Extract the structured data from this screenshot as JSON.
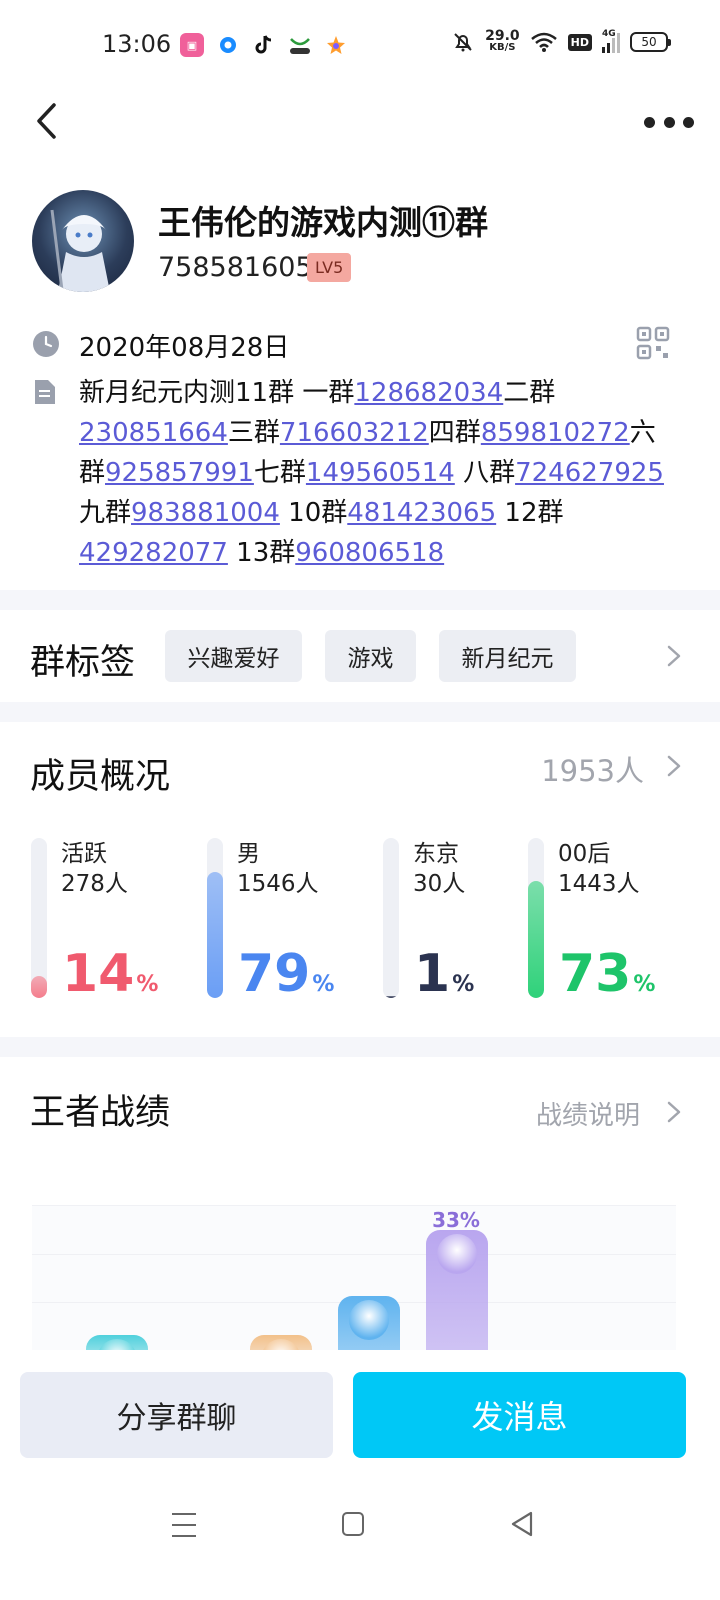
{
  "status_bar": {
    "time": "13:06",
    "speed_value": "29.0",
    "speed_unit": "KB/S",
    "hd_label": "HD",
    "network_label": "4G",
    "battery": "50",
    "app_icons": [
      "bilibili-icon",
      "browser-icon",
      "tiktok-icon",
      "game-icon",
      "star-app-icon"
    ]
  },
  "header": {
    "back_icon": "chevron-left-icon",
    "more_icon": "more-dots-icon"
  },
  "group": {
    "name": "王伟伦的游戏内测⑪群",
    "id": "758581605",
    "level": "LV5",
    "created_date": "2020年08月28日",
    "intro_segments": [
      {
        "text": "新月纪元内测11群 一群",
        "link": false
      },
      {
        "text": "128682034",
        "link": true
      },
      {
        "text": "二群",
        "link": false
      },
      {
        "text": "230851664",
        "link": true
      },
      {
        "text": "三群",
        "link": false
      },
      {
        "text": "716603212",
        "link": true
      },
      {
        "text": "四群",
        "link": false
      },
      {
        "text": "859810272",
        "link": true
      },
      {
        "text": "六群",
        "link": false
      },
      {
        "text": "925857991",
        "link": true
      },
      {
        "text": "七群",
        "link": false
      },
      {
        "text": "149560514",
        "link": true
      },
      {
        "text": " 八群",
        "link": false
      },
      {
        "text": "724627925",
        "link": true
      },
      {
        "text": " 九群",
        "link": false
      },
      {
        "text": "983881004",
        "link": true
      },
      {
        "text": " 10群",
        "link": false
      },
      {
        "text": "481423065",
        "link": true
      },
      {
        "text": " 12群",
        "link": false
      },
      {
        "text": "429282077",
        "link": true
      },
      {
        "text": " 13群",
        "link": false
      },
      {
        "text": "960806518",
        "link": true
      }
    ]
  },
  "tags": {
    "title": "群标签",
    "items": [
      "兴趣爱好",
      "游戏",
      "新月纪元"
    ]
  },
  "members": {
    "title": "成员概况",
    "count": "1953人",
    "stats": [
      {
        "label": "活跃",
        "sub": "278人",
        "pct": "14",
        "unit": "%",
        "fill": 0.14,
        "color": "#f05a6e",
        "bar_color": "#f47d8c"
      },
      {
        "label": "男",
        "sub": "1546人",
        "pct": "79",
        "unit": "%",
        "fill": 0.79,
        "color": "#4a86f0",
        "bar_color": "#6a9ef5"
      },
      {
        "label": "东京",
        "sub": "30人",
        "pct": "1",
        "unit": "%",
        "fill": 0.01,
        "color": "#2b3350",
        "bar_color": "#2b3350"
      },
      {
        "label": "00后",
        "sub": "1443人",
        "pct": "73",
        "unit": "%",
        "fill": 0.73,
        "color": "#1ec46a",
        "bar_color": "#2fd27a"
      }
    ]
  },
  "kings": {
    "title": "王者战绩",
    "link_label": "战绩说明",
    "top_rank_pct": "33%",
    "ranks": [
      {
        "name": "diamond-rank-emblem",
        "fill": 0.05,
        "color": "#4fd0dc"
      },
      {
        "name": "gold-rank-emblem",
        "fill": 0.05,
        "color": "#f2c08a"
      },
      {
        "name": "star-rank-emblem",
        "fill": 0.33,
        "color": "#5fb3ef"
      },
      {
        "name": "king-rank-emblem",
        "fill": 0.8,
        "color": "#b9a6ef"
      }
    ]
  },
  "actions": {
    "share_label": "分享群聊",
    "send_label": "发消息"
  },
  "nav": {
    "menu_icon": "menu-icon",
    "home_icon": "home-icon",
    "back_icon": "back-triangle-icon"
  }
}
